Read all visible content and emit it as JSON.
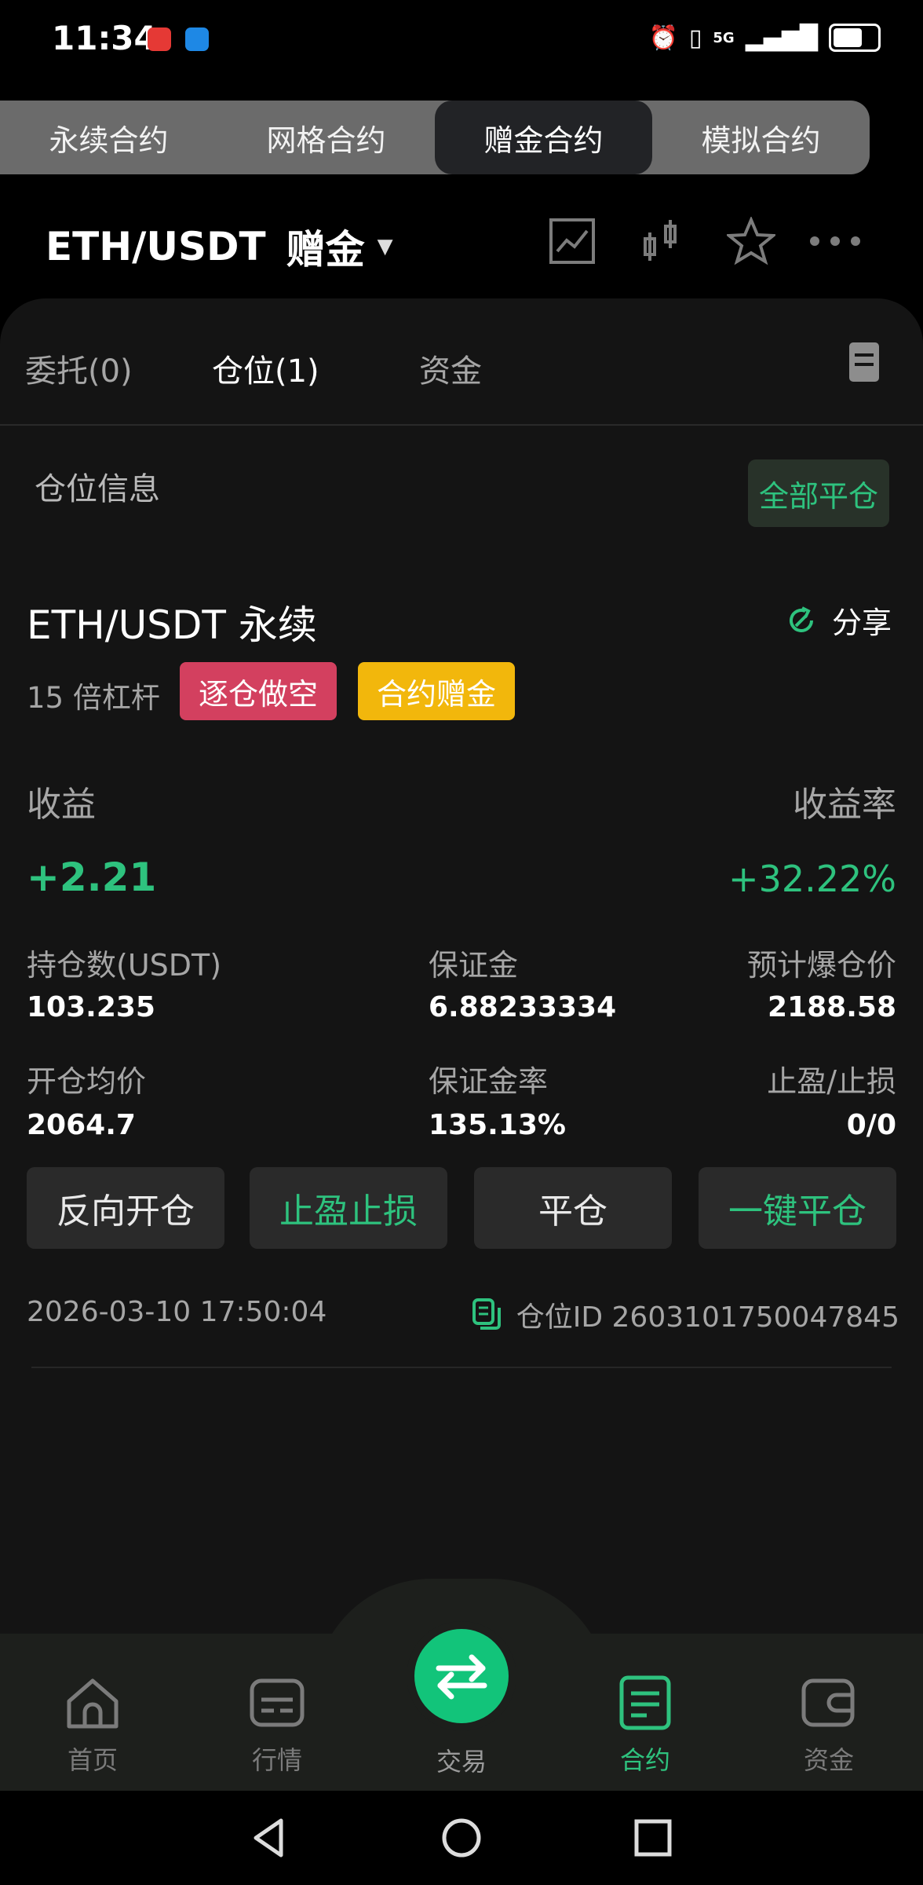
{
  "status_bar": {
    "time": "11:34",
    "network": "5G"
  },
  "segment_tabs": [
    {
      "label": "永续合约",
      "active": false
    },
    {
      "label": "网格合约",
      "active": false
    },
    {
      "label": "赠金合约",
      "active": true
    },
    {
      "label": "模拟合约",
      "active": false
    }
  ],
  "header": {
    "pair": "ETH/USDT",
    "mode": "赠金",
    "icons": [
      "chart-icon",
      "candlestick-icon",
      "star-icon",
      "more-icon"
    ]
  },
  "sub_tabs": [
    {
      "label": "委托(0)",
      "active": false
    },
    {
      "label": "仓位(1)",
      "active": true
    },
    {
      "label": "资金",
      "active": false
    }
  ],
  "position": {
    "section_title": "仓位信息",
    "close_all_label": "全部平仓",
    "title": "ETH/USDT 永续",
    "share_label": "分享",
    "leverage": "15 倍杠杆",
    "badge_short": "逐仓做空",
    "badge_bonus": "合约赠金",
    "pnl_label": "收益",
    "pnl_value": "+2.21",
    "pnl_rate_label": "收益率",
    "pnl_rate_value": "+32.22%",
    "stats": [
      {
        "key": "持仓数(USDT)",
        "value": "103.235"
      },
      {
        "key": "保证金",
        "value": "6.88233334"
      },
      {
        "key": "预计爆仓价",
        "value": "2188.58"
      },
      {
        "key": "开仓均价",
        "value": "2064.7"
      },
      {
        "key": "保证金率",
        "value": "135.13%"
      },
      {
        "key": "止盈/止损",
        "value": "0/0"
      }
    ],
    "actions": [
      {
        "label": "反向开仓",
        "green": false
      },
      {
        "label": "止盈止损",
        "green": true
      },
      {
        "label": "平仓",
        "green": false
      },
      {
        "label": "一键平仓",
        "green": true
      }
    ],
    "timestamp": "2026-03-10 17:50:04",
    "position_id": "仓位ID 2603101750047845"
  },
  "bottom_nav": [
    {
      "label": "首页",
      "icon": "home-icon",
      "active": false
    },
    {
      "label": "行情",
      "icon": "market-icon",
      "active": false
    },
    {
      "label": "交易",
      "icon": "swap-icon",
      "active": false
    },
    {
      "label": "合约",
      "icon": "contract-icon",
      "active": true
    },
    {
      "label": "资金",
      "icon": "wallet-icon",
      "active": false
    }
  ],
  "colors": {
    "accent_green": "#2ec27e",
    "short_red": "#d3405f",
    "bonus_yellow": "#f2b70c"
  }
}
